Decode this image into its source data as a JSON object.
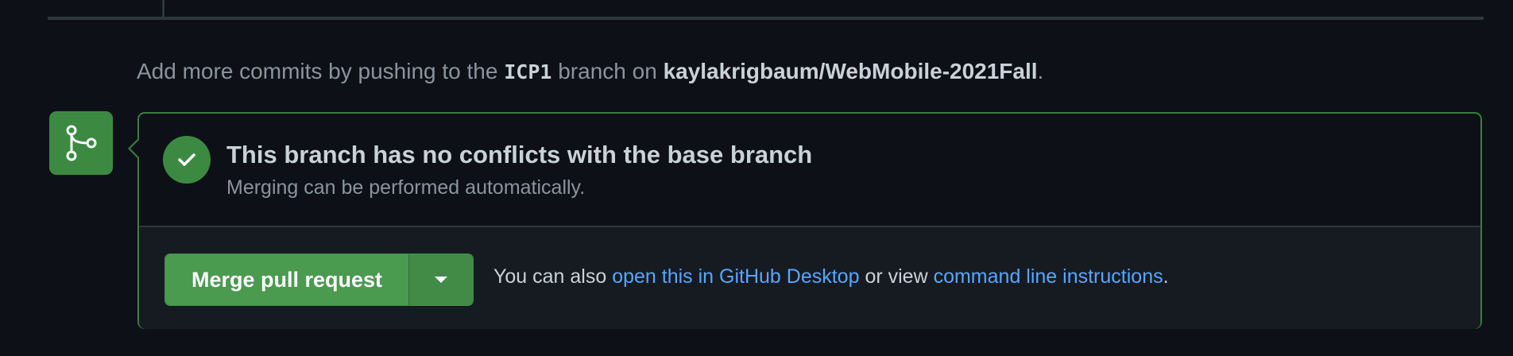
{
  "push_hint": {
    "prefix": "Add more commits by pushing to the",
    "branch": "ICP1",
    "middle": "branch on",
    "repo": "kaylakrigbaum/WebMobile-2021Fall",
    "suffix": "."
  },
  "merge_status": {
    "badge_icon": "git-branch-icon",
    "check_icon": "check-icon",
    "title": "This branch has no conflicts with the base branch",
    "subtitle": "Merging can be performed automatically."
  },
  "actions": {
    "merge_label": "Merge pull request",
    "dropdown_icon": "triangle-down-icon",
    "also_text": "You can also",
    "desktop_link": "open this in GitHub Desktop",
    "or_view": "or view",
    "cli_link": "command line instructions",
    "end": "."
  },
  "colors": {
    "success": "#3c8a42",
    "button": "#4a9a50",
    "link": "#58a6ff",
    "background": "#0d1117"
  }
}
